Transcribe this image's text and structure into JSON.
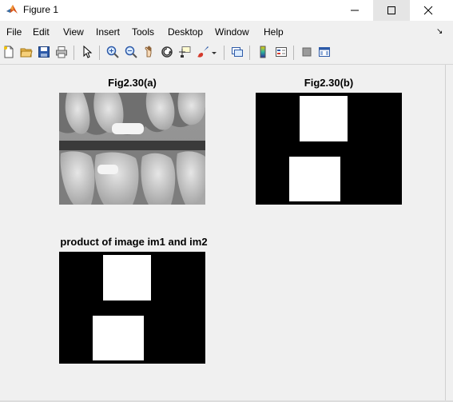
{
  "window": {
    "title": "Figure 1"
  },
  "menu": [
    "File",
    "Edit",
    "View",
    "Insert",
    "Tools",
    "Desktop",
    "Window",
    "Help"
  ],
  "toolbar_icons": [
    "new-figure-icon",
    "open-folder-icon",
    "save-icon",
    "print-icon",
    "pointer-icon",
    "zoom-in-icon",
    "zoom-out-icon",
    "pan-icon",
    "rotate-3d-icon",
    "data-cursor-icon",
    "brush-icon",
    "link-plot-icon",
    "colorbar-icon",
    "legend-icon",
    "hide-plot-tools-icon",
    "show-plot-tools-icon"
  ],
  "axes": {
    "a_title": "Fig2.30(a)",
    "b_title": "Fig2.30(b)",
    "c_title": "product of image im1 and im2"
  },
  "colors": {
    "accent": "#cc4a0a",
    "mask_background": "#000000",
    "mask_foreground": "#ffffff",
    "xray_grey": "#9a9a9a"
  }
}
